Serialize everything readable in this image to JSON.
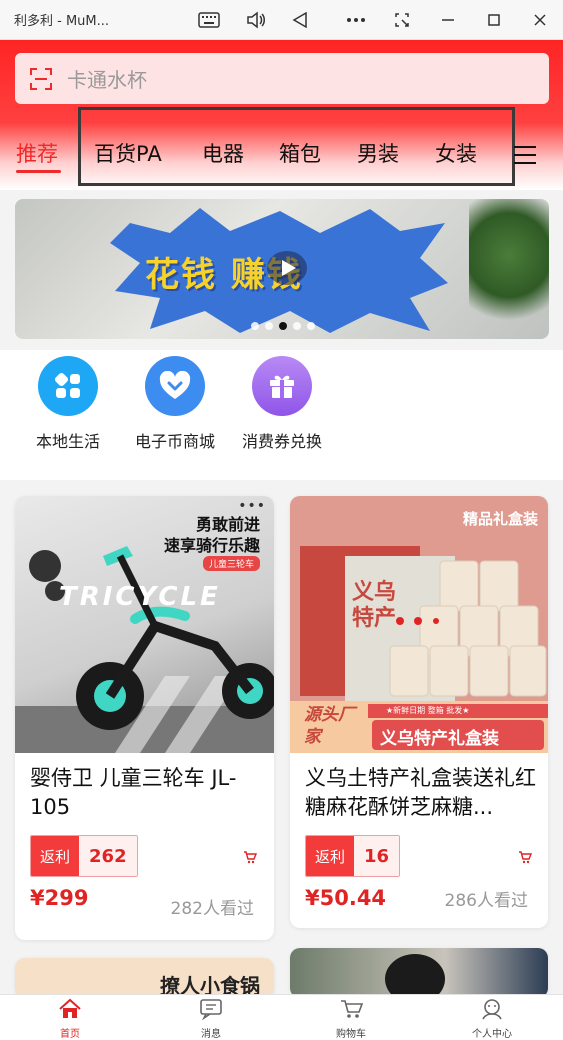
{
  "window": {
    "title": "利多利 - MuM...",
    "icons": [
      "keyboard-icon",
      "volume-icon",
      "back-icon",
      "more-icon",
      "screenshot-icon",
      "minimize-icon",
      "maximize-icon",
      "close-icon"
    ]
  },
  "search": {
    "placeholder": "卡通水杯",
    "icon": "scan-icon"
  },
  "tabs": [
    {
      "label": "推荐",
      "active": true
    },
    {
      "label": "百货PA"
    },
    {
      "label": "电器"
    },
    {
      "label": "箱包"
    },
    {
      "label": "男装"
    },
    {
      "label": "女装"
    }
  ],
  "banner": {
    "text": "花钱 赚钱",
    "slide_count": 5,
    "active_slide": 3
  },
  "entries": [
    {
      "label": "本地生活",
      "icon": "grid-icon",
      "color": "#1ea7f5"
    },
    {
      "label": "电子币商城",
      "icon": "heart-chevron-icon",
      "color": "#3d8df0"
    },
    {
      "label": "消费券兑换",
      "icon": "gift-icon",
      "color": "#a06bf0"
    }
  ],
  "products": [
    {
      "name": "婴侍卫 儿童三轮车 JL-105",
      "rebate_label": "返利",
      "rebate_value": "262",
      "price": "¥299",
      "views": "282人看过",
      "image_text": {
        "line1": "勇敢前进",
        "line2": "速享骑行乐趣",
        "tag": "儿童三轮车",
        "brand": "TRICYCLE"
      }
    },
    {
      "name": "义乌土特产礼盒装送礼红糖麻花酥饼芝麻糖...",
      "rebate_label": "返利",
      "rebate_value": "16",
      "price": "¥50.44",
      "views": "286人看过",
      "image_text": {
        "corner": "精品礼盒装",
        "box": "义乌特产",
        "strip": "★新鲜日期 整箱 批发★",
        "left": "源头厂家",
        "right": "义乌特产礼盒装"
      }
    }
  ],
  "peek": {
    "left_text": "撩人小食锅"
  },
  "bottom_nav": [
    {
      "label": "首页",
      "icon": "home-icon",
      "active": true
    },
    {
      "label": "消息",
      "icon": "message-icon"
    },
    {
      "label": "购物车",
      "icon": "cart-icon"
    },
    {
      "label": "个人中心",
      "icon": "user-icon"
    }
  ],
  "colors": {
    "brand_red": "#ee2a2a",
    "price_red": "#e02424"
  }
}
